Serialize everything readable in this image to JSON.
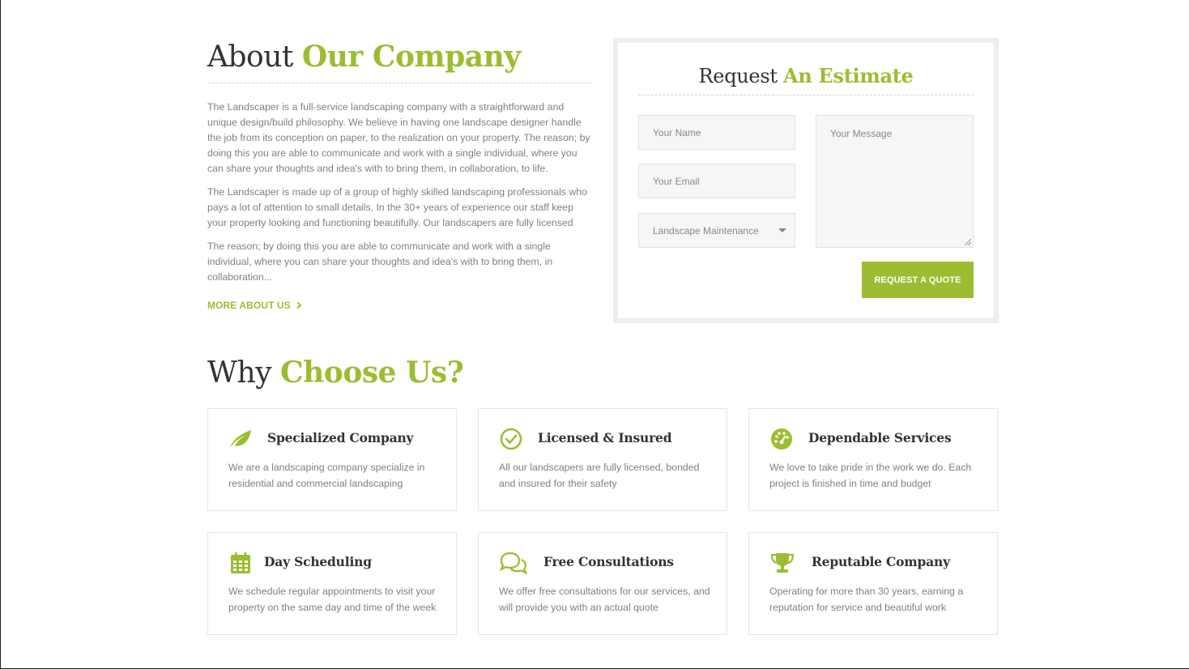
{
  "about": {
    "title_plain": "About",
    "title_accent": "Our Company",
    "paragraphs": [
      "The Landscaper is a full-service landscaping company with a straightforward and unique design/build philosophy. We believe in having one landscape designer handle the job from its conception on paper, to the realization on your property. The reason; by doing this you are able to communicate and work with a single individual, where you can share your thoughts and idea's with to bring them, in collaboration, to life.",
      "The Landscaper is made up of a group of highly skilled landscaping professionals who pays a lot of attention to small details. In the 30+ years of experience our staff keep your property looking and functioning beautifully. Our landscapers are fully licensed",
      "The reason; by doing this you are able to communicate and work with a single individual, where you can share your thoughts and idea's with to bring them, in collaboration..."
    ],
    "more_label": "MORE ABOUT US"
  },
  "estimate": {
    "title_plain": "Request",
    "title_accent": "An Estimate",
    "name_placeholder": "Your Name",
    "email_placeholder": "Your Email",
    "service_selected": "Landscape Maintenance",
    "message_placeholder": "Your Message",
    "submit_label": "REQUEST A QUOTE"
  },
  "why": {
    "title_plain": "Why",
    "title_accent": "Choose Us?",
    "cards": [
      {
        "title": "Specialized Company",
        "text": "We are a landscaping company specialize in residential and commercial landscaping",
        "icon": "leaf-icon"
      },
      {
        "title": "Licensed & Insured",
        "text": "All our landscapers are fully licensed, bonded and insured for their safety",
        "icon": "check-circle-icon"
      },
      {
        "title": "Dependable Services",
        "text": "We love to take pride in the work we do. Each project is finished in time and budget",
        "icon": "dashboard-icon"
      },
      {
        "title": "Day Scheduling",
        "text": "We schedule regular appointments to visit your property on the same day and time of the week",
        "icon": "calendar-icon"
      },
      {
        "title": "Free Consultations",
        "text": "We offer free consultations for our services, and will provide you with an actual quote",
        "icon": "chat-bubbles-icon"
      },
      {
        "title": "Reputable Company",
        "text": "Operating for more than 30 years, earning a reputation for service and beautiful work",
        "icon": "trophy-icon"
      }
    ]
  },
  "colors": {
    "accent": "#9cbd31",
    "heading": "#333333",
    "body_text": "#808080",
    "field_bg": "#f6f6f6",
    "border": "#e5e5e5"
  }
}
